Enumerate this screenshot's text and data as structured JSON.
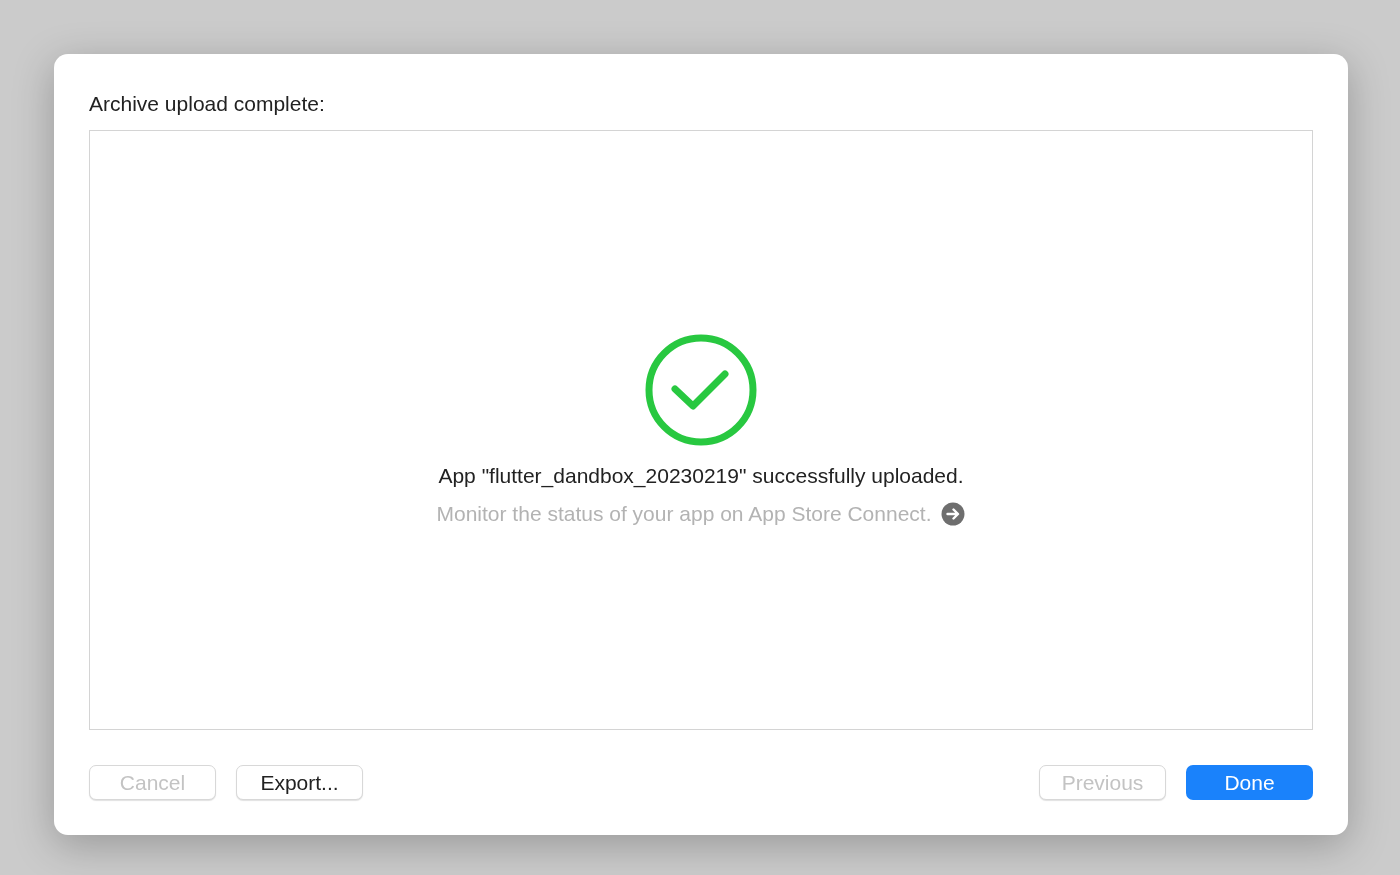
{
  "dialog": {
    "title": "Archive upload complete:",
    "message": "App \"flutter_dandbox_20230219\" successfully uploaded.",
    "link": "Monitor the status of your app on App Store Connect.",
    "buttons_left": [
      {
        "label": "Cancel",
        "kind": "default",
        "disabled": true
      },
      {
        "label": "Export...",
        "kind": "default",
        "disabled": false
      }
    ],
    "buttons_right": [
      {
        "label": "Previous",
        "kind": "default",
        "disabled": true
      },
      {
        "label": "Done",
        "kind": "primary",
        "disabled": false
      }
    ]
  }
}
